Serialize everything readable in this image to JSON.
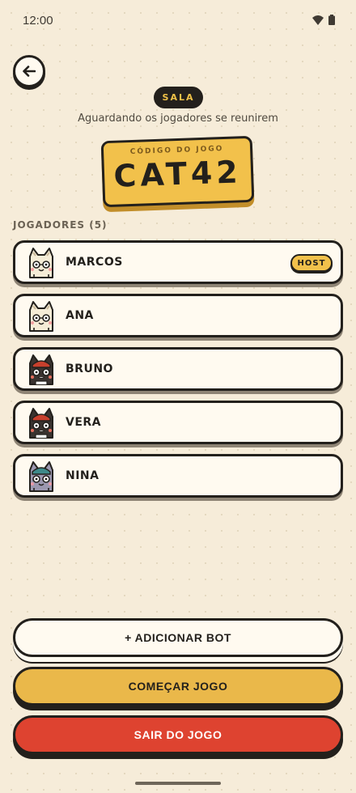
{
  "status_bar": {
    "time": "12:00"
  },
  "header": {
    "room_badge": "SALA",
    "waiting_text": "Aguardando os jogadores se reunirem"
  },
  "game_code": {
    "label": "CÓDIGO DO JOGO",
    "value": "CAT42"
  },
  "players": {
    "heading": "JOGADORES (5)",
    "list": [
      {
        "name": "MARCOS",
        "badge": "HOST",
        "avatar_icon": "cream-cat-avatar-icon"
      },
      {
        "name": "ANA",
        "avatar_icon": "cream-cat-avatar-icon"
      },
      {
        "name": "BRUNO",
        "avatar_icon": "black-cat-red-hat-avatar-icon"
      },
      {
        "name": "VERA",
        "avatar_icon": "black-cat-red-hat-avatar-icon"
      },
      {
        "name": "NINA",
        "avatar_icon": "grey-cat-blue-hat-avatar-icon"
      }
    ]
  },
  "actions": {
    "add_bot": "+ ADICIONAR BOT",
    "start_game": "COMEÇAR JOGO",
    "leave_game": "SAIR DO JOGO"
  },
  "colors": {
    "background": "#f6ecd9",
    "accent_yellow": "#f2c14b",
    "danger_red": "#de4330",
    "ink": "#23201c"
  }
}
